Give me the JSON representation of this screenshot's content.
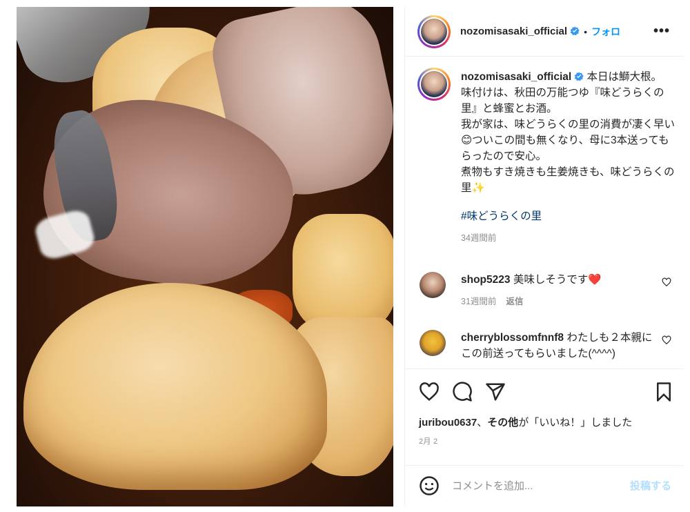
{
  "post": {
    "image_alt": "Buri daikon (yellowtail and daikon simmered) in a pot",
    "colors": {
      "accent": "#0095f6",
      "hashtag": "#00376b",
      "muted": "#8e8e8e",
      "heart": "#ed4956",
      "verified": "#3897f0"
    }
  },
  "header": {
    "username": "nozomisasaki_official",
    "separator": "•",
    "follow_label": "フォロ",
    "more_label": "•••"
  },
  "caption": {
    "username": "nozomisasaki_official",
    "text_lines": [
      "本日は鰤大根。",
      "味付けは、秋田の万能つゆ『味どうらくの里』と蜂蜜とお酒。",
      "我が家は、味どうらくの里の消費が凄く早い😊ついこの間も無くなり、母に3本送ってもらったので安心。",
      "煮物もすき焼きも生姜焼きも、味どうらくの里✨"
    ],
    "hashtag": "#味どうらくの里",
    "time": "34週間前"
  },
  "comments": [
    {
      "username": "shop5223",
      "text": "美味しそうです❤️",
      "time": "31週間前",
      "reply_label": "返信"
    },
    {
      "username": "cherryblossomfnnf8",
      "text": "わたしも２本親にこの前送ってもらいました(^^^^)",
      "time": "",
      "reply_label": ""
    }
  ],
  "actions": {
    "like_icon": "heart-icon",
    "comment_icon": "comment-icon",
    "share_icon": "send-icon",
    "save_icon": "bookmark-icon"
  },
  "likes": {
    "first_user": "juribou0637",
    "sep": "、",
    "others_label": "その他",
    "suffix": "が「いいね！」しました"
  },
  "date": "2月 2",
  "add_comment": {
    "placeholder": "コメントを追加...",
    "post_label": "投稿する",
    "emoji_icon": "smiley-icon"
  }
}
